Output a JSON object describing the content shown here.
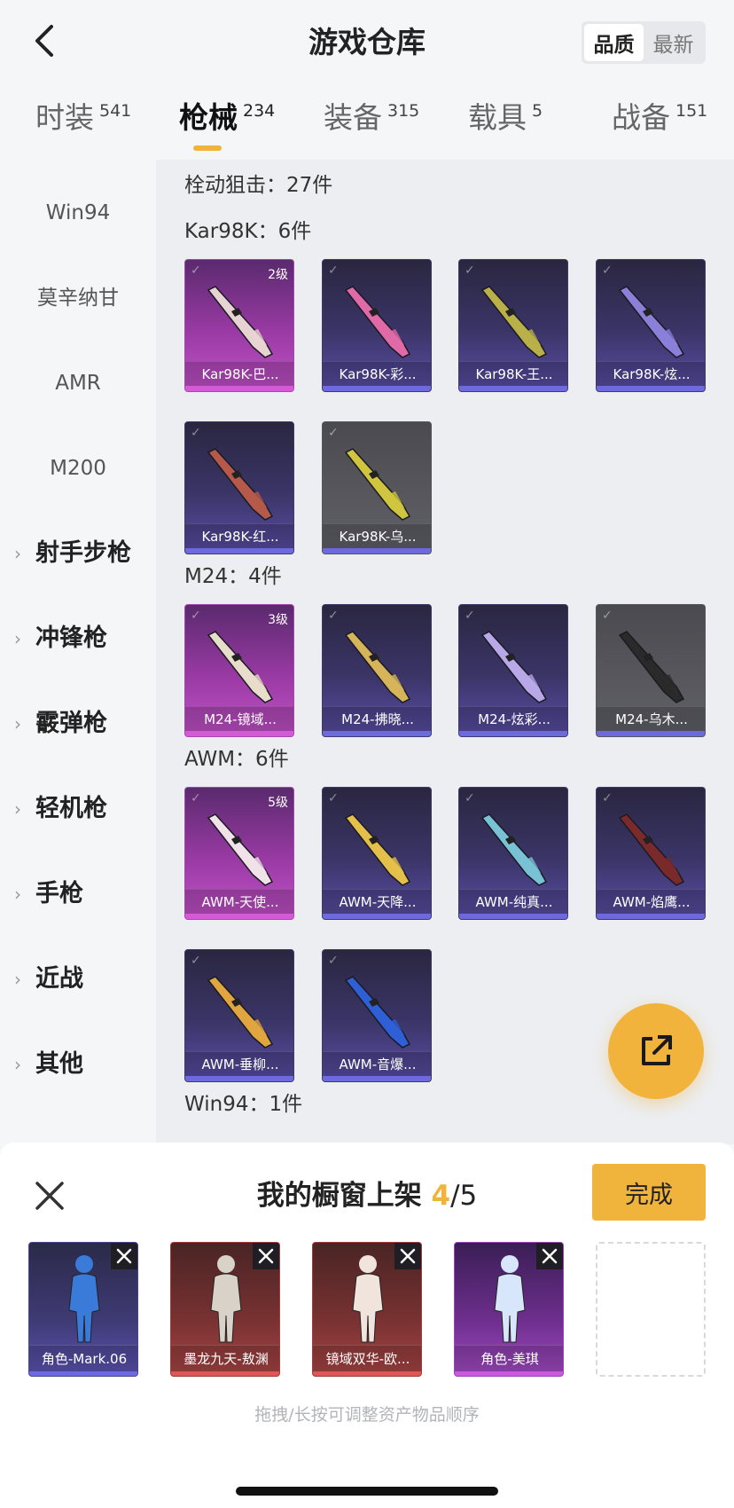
{
  "header": {
    "title": "游戏仓库",
    "sort": {
      "options": [
        "品质",
        "最新"
      ],
      "selected": "品质"
    }
  },
  "tabs": [
    {
      "label": "时装",
      "count": "541"
    },
    {
      "label": "枪械",
      "count": "234",
      "active": true
    },
    {
      "label": "装备",
      "count": "315"
    },
    {
      "label": "载具",
      "count": "5"
    },
    {
      "label": "战备",
      "count": "151"
    }
  ],
  "sidebar": {
    "sub_items": [
      "Win94",
      "莫辛纳甘",
      "AMR",
      "M200"
    ],
    "categories": [
      "射手步枪",
      "冲锋枪",
      "霰弹枪",
      "轻机枪",
      "手枪",
      "近战",
      "其他"
    ]
  },
  "content": {
    "section_title": "栓动狙击：27件",
    "groups": [
      {
        "title": "Kar98K：6件",
        "items": [
          {
            "label": "Kar98K-巴...",
            "tier": "pink",
            "level": "2级"
          },
          {
            "label": "Kar98K-彩...",
            "tier": "purple"
          },
          {
            "label": "Kar98K-王...",
            "tier": "purple"
          },
          {
            "label": "Kar98K-炫...",
            "tier": "purple"
          },
          {
            "label": "Kar98K-红...",
            "tier": "purple"
          },
          {
            "label": "Kar98K-乌...",
            "tier": "gray"
          }
        ]
      },
      {
        "title": "M24：4件",
        "items": [
          {
            "label": "M24-镜域...",
            "tier": "pink",
            "level": "3级"
          },
          {
            "label": "M24-拂晓...",
            "tier": "purple"
          },
          {
            "label": "M24-炫彩...",
            "tier": "purple"
          },
          {
            "label": "M24-乌木...",
            "tier": "gray"
          }
        ]
      },
      {
        "title": "AWM：6件",
        "items": [
          {
            "label": "AWM-天使...",
            "tier": "pink",
            "level": "5级"
          },
          {
            "label": "AWM-天降...",
            "tier": "purple"
          },
          {
            "label": "AWM-纯真...",
            "tier": "purple"
          },
          {
            "label": "AWM-焰鹰...",
            "tier": "purple"
          },
          {
            "label": "AWM-垂柳...",
            "tier": "purple"
          },
          {
            "label": "AWM-音爆...",
            "tier": "purple"
          }
        ]
      },
      {
        "title": "Win94：1件",
        "items": []
      }
    ]
  },
  "showcase": {
    "title": "我的橱窗上架",
    "count_current": "4",
    "count_sep_total": "/5",
    "done_label": "完成",
    "slots": [
      {
        "label": "角色-Mark.06",
        "tier": "purple"
      },
      {
        "label": "墨龙九天-敖渊",
        "tier": "red"
      },
      {
        "label": "镜域双华-欧...",
        "tier": "red"
      },
      {
        "label": "角色-美琪",
        "tier": "violet"
      },
      {
        "label": "",
        "tier": "empty"
      }
    ],
    "hint": "拖拽/长按可调整资产物品顺序"
  },
  "colors": {
    "accent": "#f0b43c",
    "purple_tier": "#6d6adf",
    "pink_tier": "#d65ad8"
  }
}
